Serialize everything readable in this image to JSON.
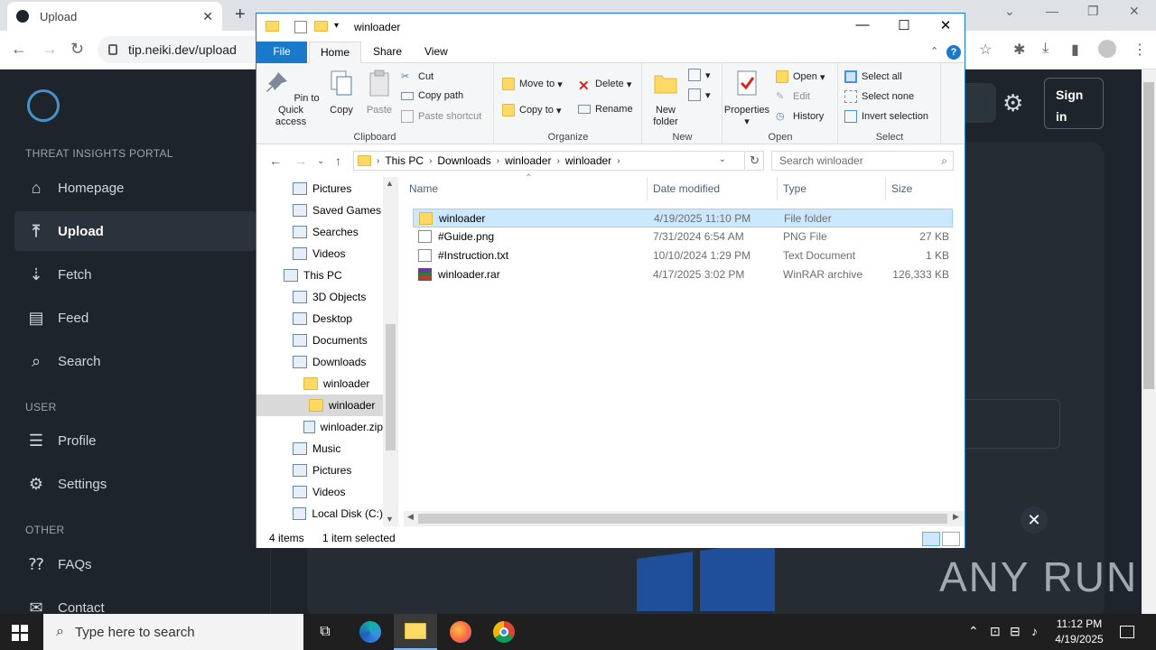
{
  "browser": {
    "tab_title": "Upload",
    "url": "tip.neiki.dev/upload",
    "new_tab": "+",
    "tab_close": "✕"
  },
  "site": {
    "sections": {
      "portal": "THREAT INSIGHTS PORTAL",
      "user": "USER",
      "other": "OTHER"
    },
    "nav": [
      {
        "label": "Homepage",
        "icon": "home-icon"
      },
      {
        "label": "Upload",
        "icon": "upload-icon",
        "active": true
      },
      {
        "label": "Fetch",
        "icon": "download-icon"
      },
      {
        "label": "Feed",
        "icon": "feed-icon"
      },
      {
        "label": "Search",
        "icon": "search-icon"
      },
      {
        "label": "Profile",
        "icon": "profile-icon"
      },
      {
        "label": "Settings",
        "icon": "gear-icon"
      },
      {
        "label": "FAQs",
        "icon": "faq-icon"
      },
      {
        "label": "Contact",
        "icon": "contact-icon"
      }
    ],
    "signin": "Sign in",
    "close_glyph": "✕"
  },
  "watermark": "ANY RUN",
  "explorer": {
    "title": "winloader",
    "tabs": {
      "file": "File",
      "home": "Home",
      "share": "Share",
      "view": "View"
    },
    "help": "?",
    "ribbon": {
      "clipboard": {
        "label": "Clipboard",
        "pin": "Pin to Quick access",
        "copy": "Copy",
        "paste": "Paste",
        "cut": "Cut",
        "copy_path": "Copy path",
        "paste_shortcut": "Paste shortcut"
      },
      "organize": {
        "label": "Organize",
        "move_to": "Move to",
        "copy_to": "Copy to",
        "delete": "Delete",
        "rename": "Rename"
      },
      "new": {
        "label": "New",
        "new_folder": "New folder"
      },
      "open": {
        "label": "Open",
        "properties": "Properties",
        "open": "Open",
        "edit": "Edit",
        "history": "History"
      },
      "select": {
        "label": "Select",
        "select_all": "Select all",
        "select_none": "Select none",
        "invert": "Invert selection"
      }
    },
    "address": {
      "crumbs": [
        "This PC",
        "Downloads",
        "winloader",
        "winloader"
      ],
      "search_placeholder": "Search winloader"
    },
    "nav_tree": [
      {
        "label": "Pictures",
        "indent": 1
      },
      {
        "label": "Saved Games",
        "indent": 1
      },
      {
        "label": "Searches",
        "indent": 1
      },
      {
        "label": "Videos",
        "indent": 1
      },
      {
        "label": "This PC",
        "indent": 0
      },
      {
        "label": "3D Objects",
        "indent": 1
      },
      {
        "label": "Desktop",
        "indent": 1
      },
      {
        "label": "Documents",
        "indent": 1
      },
      {
        "label": "Downloads",
        "indent": 1
      },
      {
        "label": "winloader",
        "indent": 2
      },
      {
        "label": "winloader",
        "indent": 3,
        "highlighted": true
      },
      {
        "label": "winloader.zip",
        "indent": 2
      },
      {
        "label": "Music",
        "indent": 1
      },
      {
        "label": "Pictures",
        "indent": 1
      },
      {
        "label": "Videos",
        "indent": 1
      },
      {
        "label": "Local Disk (C:)",
        "indent": 1
      }
    ],
    "columns": {
      "name": "Name",
      "date": "Date modified",
      "type": "Type",
      "size": "Size"
    },
    "files": [
      {
        "name": "winloader",
        "date": "4/19/2025 11:10 PM",
        "type": "File folder",
        "size": "",
        "icon": "folder-icon",
        "selected": true
      },
      {
        "name": "#Guide.png",
        "date": "7/31/2024 6:54 AM",
        "type": "PNG File",
        "size": "27 KB",
        "icon": "image-file-icon"
      },
      {
        "name": "#Instruction.txt",
        "date": "10/10/2024 1:29 PM",
        "type": "Text Document",
        "size": "1 KB",
        "icon": "text-file-icon"
      },
      {
        "name": "winloader.rar",
        "date": "4/17/2025 3:02 PM",
        "type": "WinRAR archive",
        "size": "126,333 KB",
        "icon": "winrar-icon"
      }
    ],
    "status": {
      "count": "4 items",
      "selected": "1 item selected"
    }
  },
  "taskbar": {
    "search_placeholder": "Type here to search",
    "time": "11:12 PM",
    "date": "4/19/2025"
  }
}
